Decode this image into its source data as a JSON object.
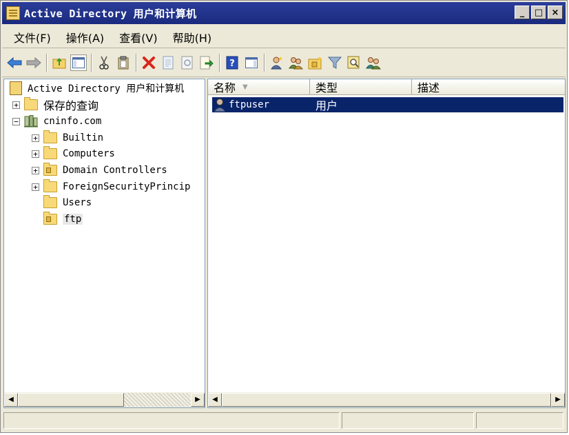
{
  "window": {
    "title": "Active Directory 用户和计算机",
    "icon": "console-snapin-icon",
    "controls": {
      "minimize": "_",
      "maximize": "□",
      "close": "×"
    }
  },
  "menu": {
    "items": [
      {
        "label": "文件(F)"
      },
      {
        "label": "操作(A)"
      },
      {
        "label": "查看(V)"
      },
      {
        "label": "帮助(H)"
      }
    ]
  },
  "toolbar": {
    "buttons": [
      "back-icon",
      "forward-icon",
      "up-level-icon",
      "show-hide-tree-icon",
      "cut-icon",
      "paste-icon",
      "delete-icon",
      "properties-icon",
      "refresh-icon",
      "export-list-icon",
      "help-icon",
      "action-pane-icon",
      "new-user-icon",
      "new-group-icon",
      "new-ou-icon",
      "filter-icon",
      "find-icon",
      "add-to-group-icon"
    ]
  },
  "tree": {
    "root": "Active Directory 用户和计算机",
    "saved_queries": "保存的查询",
    "domain": "cninfo.com",
    "children": [
      {
        "label": "Builtin",
        "expander": "+",
        "type": "folder"
      },
      {
        "label": "Computers",
        "expander": "+",
        "type": "folder"
      },
      {
        "label": "Domain Controllers",
        "expander": "+",
        "type": "ou"
      },
      {
        "label": "ForeignSecurityPrincip",
        "expander": "+",
        "type": "folder"
      },
      {
        "label": "Users",
        "expander": "",
        "type": "folder"
      },
      {
        "label": "ftp",
        "expander": "",
        "type": "ou"
      }
    ],
    "expanders": {
      "saved_queries": "+",
      "domain": "−"
    }
  },
  "list": {
    "columns": [
      {
        "label": "名称",
        "sort": "▼"
      },
      {
        "label": "类型"
      },
      {
        "label": "描述"
      }
    ],
    "rows": [
      {
        "name": "ftpuser",
        "type": "用户",
        "description": ""
      }
    ]
  },
  "colors": {
    "title_bar": "#1a2a7e",
    "selection": "#0a246a",
    "window_face": "#ece9d8"
  }
}
